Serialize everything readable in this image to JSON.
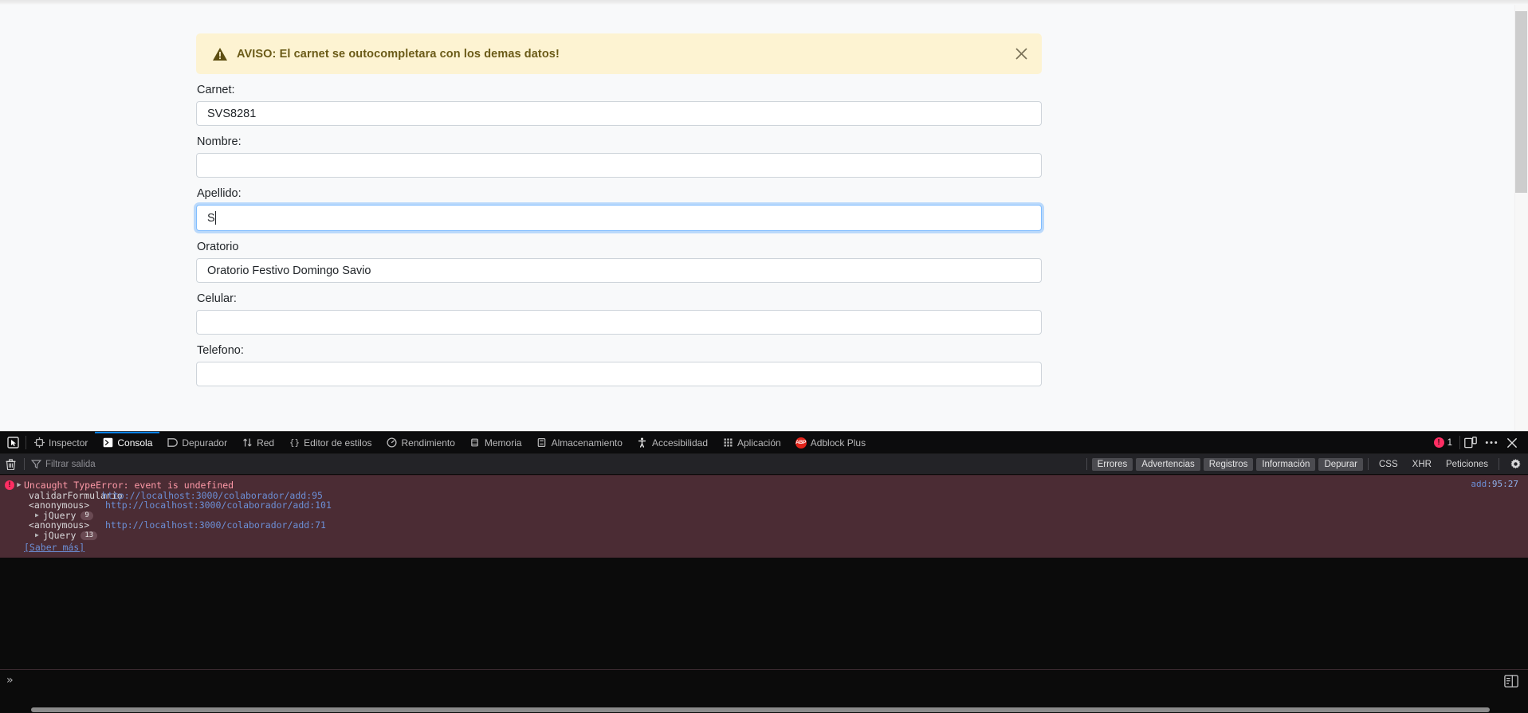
{
  "page": {
    "alert": {
      "icon": "warning-triangle-icon",
      "text": "AVISO: El carnet se outocompletara con los demas datos!",
      "close_label": "×",
      "bg_color": "#fdf3d2",
      "text_color": "#6b5b18"
    },
    "fields": [
      {
        "label": "Carnet:",
        "value": "SVS8281",
        "placeholder": "",
        "focused": false
      },
      {
        "label": "Nombre:",
        "value": "",
        "placeholder": "",
        "focused": false
      },
      {
        "label": "Apellido:",
        "value": "S",
        "placeholder": "",
        "focused": true
      },
      {
        "label": "Oratorio",
        "value": "Oratorio Festivo Domingo Savio",
        "placeholder": "",
        "focused": false
      },
      {
        "label": "Celular:",
        "value": "",
        "placeholder": "",
        "focused": false
      },
      {
        "label": "Telefono:",
        "value": "",
        "placeholder": "",
        "focused": false
      }
    ],
    "focus_color": "#80bdff"
  },
  "devtools": {
    "toolbar": {
      "picker_icon": "element-picker-icon",
      "tabs": [
        {
          "label": "Inspector",
          "icon": "inspector-icon",
          "active": false
        },
        {
          "label": "Consola",
          "icon": "console-icon",
          "active": true
        },
        {
          "label": "Depurador",
          "icon": "debugger-icon",
          "active": false
        },
        {
          "label": "Red",
          "icon": "network-icon",
          "active": false
        },
        {
          "label": "Editor de estilos",
          "icon": "style-editor-icon",
          "active": false
        },
        {
          "label": "Rendimiento",
          "icon": "performance-icon",
          "active": false
        },
        {
          "label": "Memoria",
          "icon": "memory-icon",
          "active": false
        },
        {
          "label": "Almacenamiento",
          "icon": "storage-icon",
          "active": false
        },
        {
          "label": "Accesibilidad",
          "icon": "accessibility-icon",
          "active": false
        },
        {
          "label": "Aplicación",
          "icon": "application-icon",
          "active": false
        },
        {
          "label": "Adblock Plus",
          "icon": "adblock-plus-icon",
          "active": false
        }
      ],
      "error_count": "1",
      "error_badge_glyph": "!",
      "responsive_icon": "responsive-design-mode-icon",
      "meatball_icon": "more-options-icon",
      "close_icon": "close-devtools-icon",
      "active_tab_underline_color": "#0a84ff"
    },
    "filterbar": {
      "trash_icon": "clear-console-icon",
      "funnel_icon": "filter-icon",
      "filter_placeholder": "Filtrar salida",
      "filter_value": "",
      "toggles": [
        {
          "label": "Errores",
          "on": true
        },
        {
          "label": "Advertencias",
          "on": true
        },
        {
          "label": "Registros",
          "on": true
        },
        {
          "label": "Información",
          "on": true
        },
        {
          "label": "Depurar",
          "on": true
        }
      ],
      "plain_filters": [
        "CSS",
        "XHR",
        "Peticiones"
      ],
      "gear_icon": "console-settings-icon"
    },
    "console": {
      "messages": [
        {
          "severity": "error",
          "severity_glyph": "!",
          "twisty": "▶",
          "title": "Uncaught TypeError: event is undefined",
          "location": "add:95:27",
          "location_file": "add",
          "location_pos": ":95:27",
          "stack": [
            {
              "fn": "validarFormulario",
              "url": "http://localhost:3000/colaborador/add",
              "line": ":95"
            },
            {
              "fn": "<anonymous>",
              "url": "http://localhost:3000/colaborador/add",
              "line": ":101"
            }
          ],
          "jquery_frames": [
            {
              "label": "jQuery",
              "count": "9",
              "after_index": 1
            },
            {
              "label": "jQuery",
              "count": "13",
              "after_index": 2
            }
          ],
          "stack2": [
            {
              "fn": "<anonymous>",
              "url": "http://localhost:3000/colaborador/add",
              "line": ":71"
            }
          ],
          "learn_more": "[Saber más]",
          "bg_color": "#4b2c34"
        }
      ]
    },
    "input": {
      "prompt": "»",
      "value": "",
      "editor_toggle_icon": "editor-mode-icon"
    }
  }
}
